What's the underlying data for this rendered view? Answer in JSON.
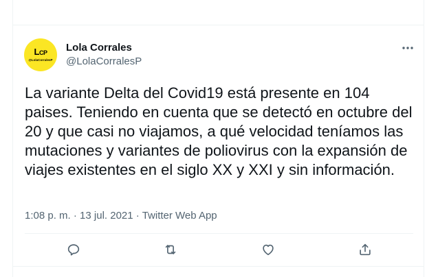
{
  "author": {
    "display_name": "Lola Corrales",
    "handle": "@LolaCorralesP",
    "avatar": {
      "logo_text_main": "L",
      "logo_text_sub": "CP",
      "logo_handle": "@LolaCorralesP",
      "background": "#fbe624"
    }
  },
  "tweet": {
    "text": "La variante Delta del Covid19 está presente en 104 paises. Teniendo en cuenta que se detectó en octubre del 20 y que casi no viajamos, a qué velocidad teníamos las mutaciones y variantes de poliovirus con la expansión de viajes existentes en el siglo XX y XXI y sin información.",
    "time": "1:08 p. m.",
    "separator": "·",
    "date": "13 jul. 2021",
    "source": "Twitter Web App"
  },
  "actions": {
    "icons": [
      "reply-icon",
      "retweet-icon",
      "like-icon",
      "share-icon"
    ],
    "more_icon": "more-options-icon"
  },
  "colors": {
    "text_primary": "#0f1419",
    "text_secondary": "#536471",
    "divider": "#eff3f4",
    "avatar_bg": "#fbe624"
  }
}
